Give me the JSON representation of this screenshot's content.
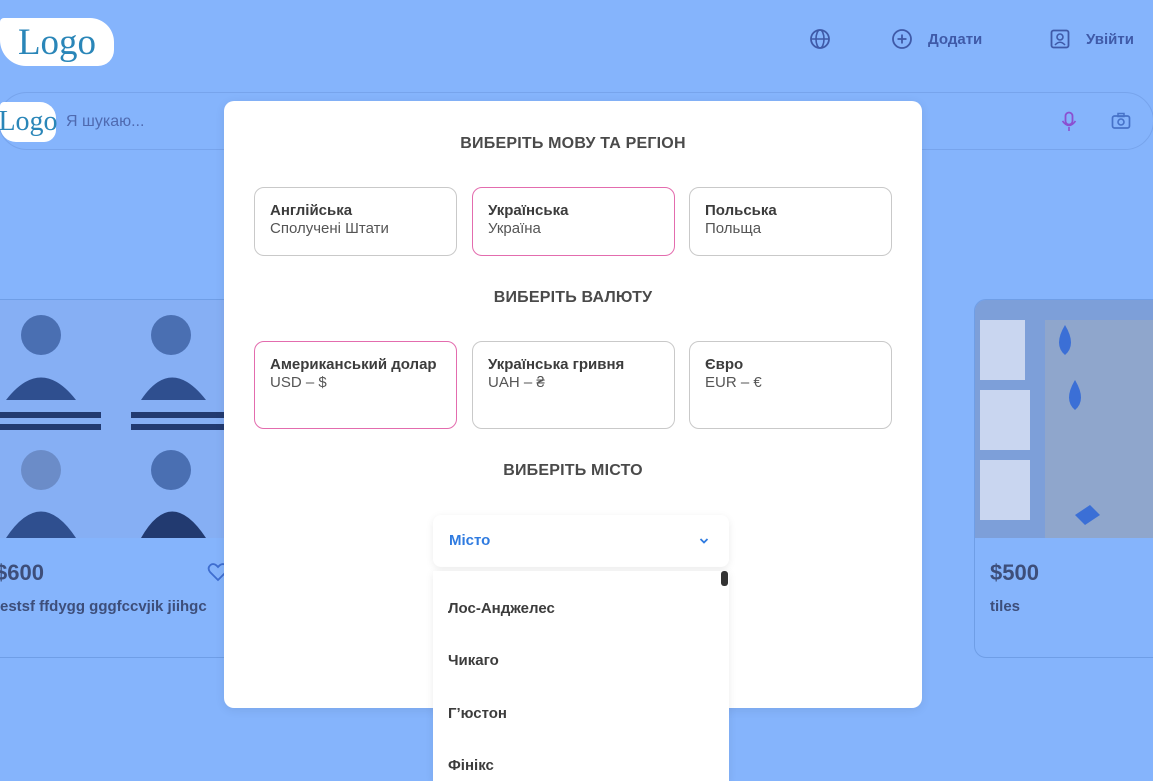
{
  "header": {
    "logo_text": "Logo",
    "add_label": "Додати",
    "login_label": "Увійти",
    "icons": [
      "globe-icon",
      "plus-circle-icon",
      "user-icon",
      "microphone-icon",
      "camera-icon"
    ]
  },
  "search": {
    "logo_text": "Logo",
    "placeholder": "Я шукаю..."
  },
  "cards": [
    {
      "price": "$600",
      "title": "testsf ffdygg gggfccvjik jiihgc"
    },
    {
      "price": "$500",
      "title": "tiles"
    }
  ],
  "modal": {
    "language_title": "ВИБЕРІТЬ МОВУ ТА РЕГІОН",
    "languages": [
      {
        "title": "Англійська",
        "sub": "Сполучені Штати",
        "selected": false
      },
      {
        "title": "Українська",
        "sub": "Україна",
        "selected": true
      },
      {
        "title": "Польська",
        "sub": "Польща",
        "selected": false
      }
    ],
    "currency_title": "ВИБЕРІТЬ ВАЛЮТУ",
    "currencies": [
      {
        "title": "Американський долар",
        "sub": "USD – $",
        "selected": true
      },
      {
        "title": "Українська гривня",
        "sub": "UAH – ₴",
        "selected": false
      },
      {
        "title": "Євро",
        "sub": "EUR – €",
        "selected": false
      }
    ],
    "city_title": "ВИБЕРІТЬ МІСТО",
    "city_select_label": "Місто",
    "cities": [
      "Лос-Анджелес",
      "Чикаго",
      "Г’юстон",
      "Фінікс"
    ]
  },
  "colors": {
    "overlay_bg": "#85b4fc",
    "selected_border": "#e36cae",
    "accent_blue": "#2f7be0"
  }
}
